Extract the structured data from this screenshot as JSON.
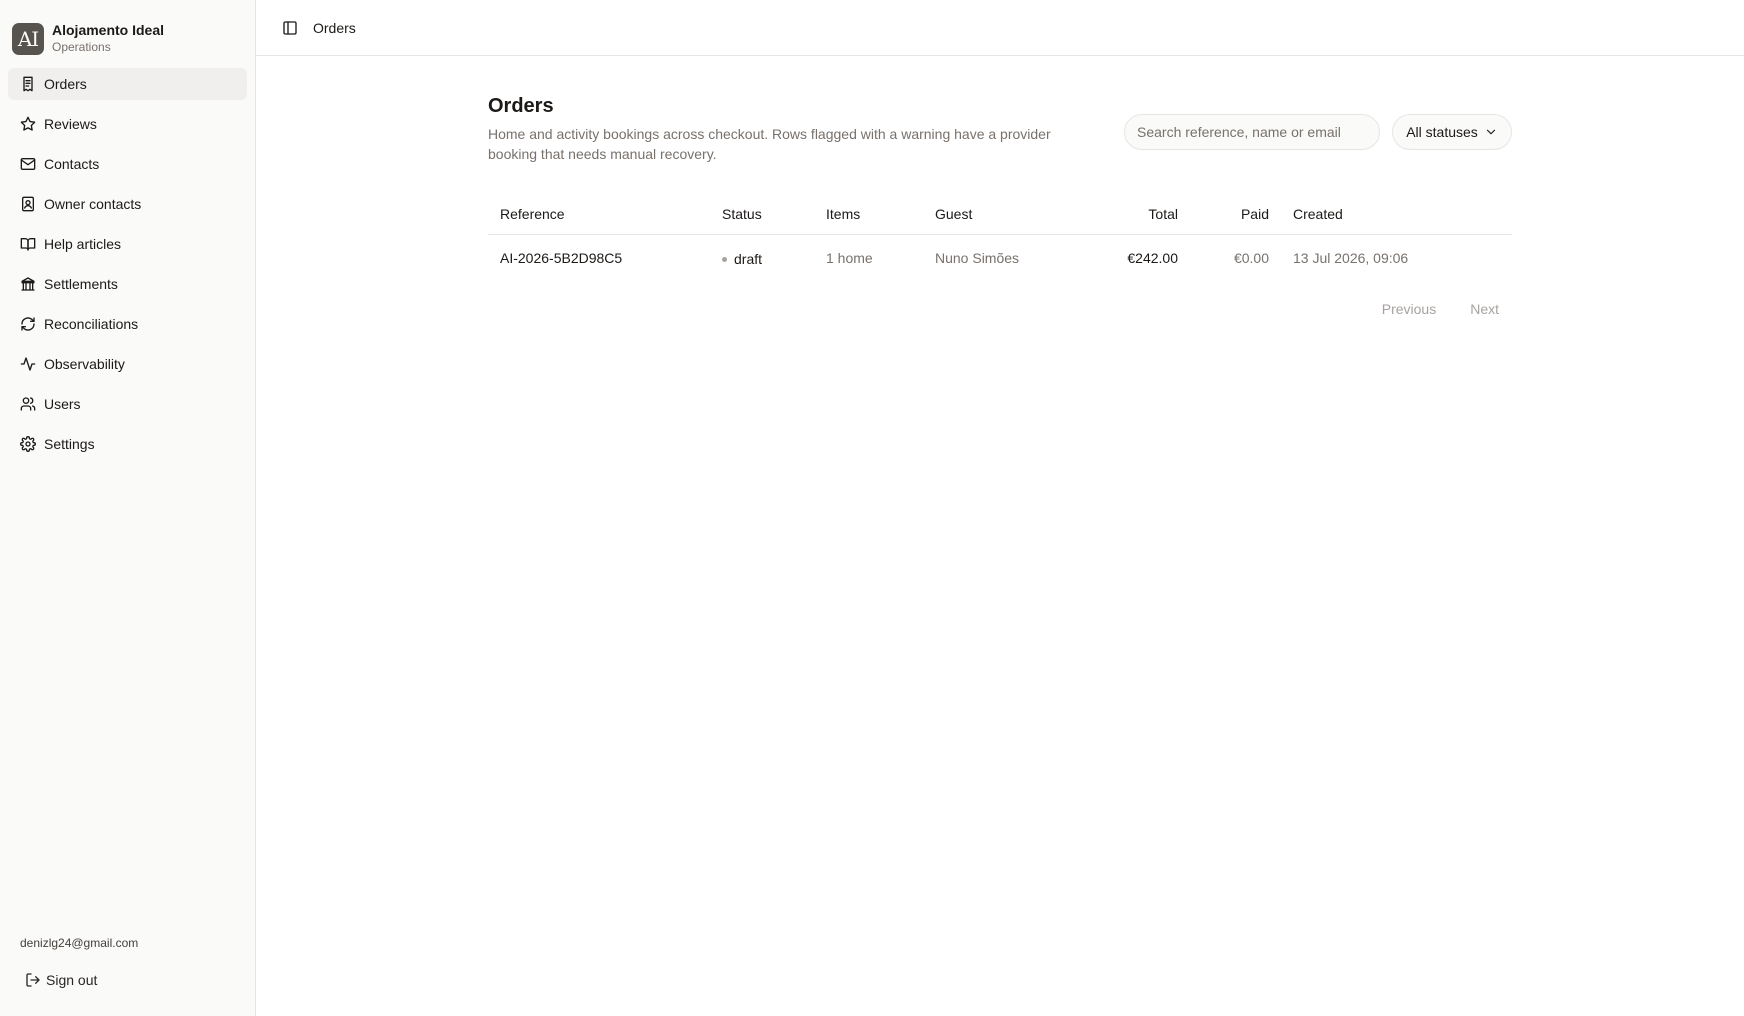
{
  "brand": {
    "logo": "AI",
    "name": "Alojamento Ideal",
    "subtitle": "Operations"
  },
  "sidebar": {
    "items": [
      {
        "label": "Orders",
        "icon": "receipt-icon",
        "active": true
      },
      {
        "label": "Reviews",
        "icon": "star-icon"
      },
      {
        "label": "Contacts",
        "icon": "mail-icon"
      },
      {
        "label": "Owner contacts",
        "icon": "contact-book-icon"
      },
      {
        "label": "Help articles",
        "icon": "book-icon"
      },
      {
        "label": "Settlements",
        "icon": "bank-icon"
      },
      {
        "label": "Reconciliations",
        "icon": "refresh-icon"
      },
      {
        "label": "Observability",
        "icon": "activity-icon"
      },
      {
        "label": "Users",
        "icon": "users-icon"
      },
      {
        "label": "Settings",
        "icon": "gear-icon"
      }
    ],
    "user_email": "denizlg24@gmail.com",
    "sign_out": "Sign out"
  },
  "topbar": {
    "title": "Orders"
  },
  "page": {
    "title": "Orders",
    "description": "Home and activity bookings across checkout. Rows flagged with a warning have a provider booking that needs manual recovery.",
    "search_placeholder": "Search reference, name or email",
    "status_filter": "All statuses"
  },
  "table": {
    "columns": [
      "Reference",
      "Status",
      "Items",
      "Guest",
      "Total",
      "Paid",
      "Created"
    ],
    "rows": [
      {
        "reference": "AI-2026-5B2D98C5",
        "status": "draft",
        "items": "1 home",
        "guest": "Nuno Simões",
        "total": "€242.00",
        "paid": "€0.00",
        "created": "13 Jul 2026, 09:06"
      }
    ]
  },
  "pagination": {
    "previous": "Previous",
    "next": "Next"
  }
}
